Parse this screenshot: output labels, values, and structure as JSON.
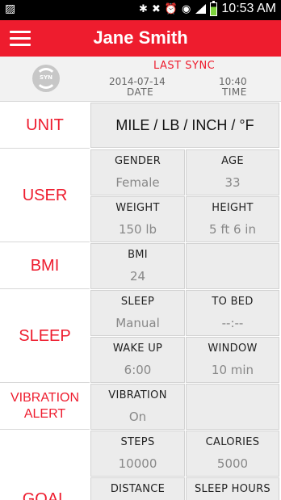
{
  "statusbar": {
    "time": "10:53 AM",
    "left_icon": "notification-icon",
    "icons": [
      "bluetooth-icon",
      "mute-icon",
      "alarm-icon",
      "wifi-icon",
      "signal-icon",
      "battery-icon"
    ]
  },
  "header": {
    "title": "Jane Smith",
    "menu_icon": "hamburger-menu-icon",
    "color": "#ee1c2e"
  },
  "sync": {
    "icon_text": "SYN",
    "label": "LAST SYNC",
    "date_value": "2014-07-14",
    "date_label": "DATE",
    "time_value": "10:40",
    "time_label": "TIME"
  },
  "sections": {
    "unit": {
      "label": "UNIT",
      "value": "MILE / LB / INCH / °F"
    },
    "user": {
      "label": "USER",
      "gender": {
        "title": "GENDER",
        "value": "Female"
      },
      "age": {
        "title": "AGE",
        "value": "33"
      },
      "weight": {
        "title": "WEIGHT",
        "value": "150 lb"
      },
      "height": {
        "title": "HEIGHT",
        "value": "5 ft 6 in"
      }
    },
    "bmi": {
      "label": "BMI",
      "bmi": {
        "title": "BMI",
        "value": "24"
      }
    },
    "sleep": {
      "label": "SLEEP",
      "sleep": {
        "title": "SLEEP",
        "value": "Manual"
      },
      "to_bed": {
        "title": "TO BED",
        "value": "--:--"
      },
      "wake_up": {
        "title": "WAKE UP",
        "value": "6:00"
      },
      "window": {
        "title": "WINDOW",
        "value": "10 min"
      }
    },
    "vibration": {
      "label_line1": "VIBRATION",
      "label_line2": "ALERT",
      "vibration": {
        "title": "VIBRATION",
        "value": "On"
      }
    },
    "goal": {
      "label": "GOAL",
      "steps": {
        "title": "STEPS",
        "value": "10000"
      },
      "calories": {
        "title": "CALORIES",
        "value": "5000"
      },
      "distance": {
        "title": "DISTANCE",
        "value": ""
      },
      "sleep_hours": {
        "title": "SLEEP HOURS",
        "value": ""
      }
    }
  }
}
